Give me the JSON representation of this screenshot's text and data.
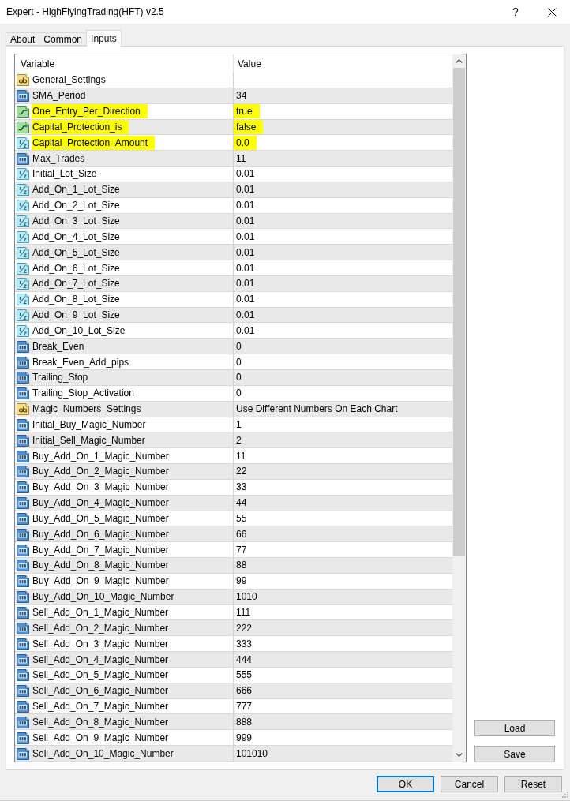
{
  "window": {
    "title": "Expert - HighFlyingTrading(HFT) v2.5",
    "help": "?"
  },
  "tabs": [
    {
      "label": "About",
      "selected": false
    },
    {
      "label": "Common",
      "selected": false
    },
    {
      "label": "Inputs",
      "selected": true
    }
  ],
  "inputs": {
    "columns": [
      "Variable",
      "Value"
    ],
    "rows": [
      {
        "kind": "string",
        "variable": "General_Settings",
        "highlighted": false
      },
      {
        "kind": "int",
        "variable": "SMA_Period",
        "value": "34",
        "highlighted": false
      },
      {
        "kind": "bool",
        "variable": "One_Entry_Per_Direction",
        "value": "true",
        "highlighted": true
      },
      {
        "kind": "bool",
        "variable": "Capital_Protection_is",
        "value": "false",
        "highlighted": true
      },
      {
        "kind": "double",
        "variable": "Capital_Protection_Amount",
        "value": "0.0",
        "highlighted": true
      },
      {
        "kind": "int",
        "variable": "Max_Trades",
        "value": "11",
        "highlighted": false
      },
      {
        "kind": "double",
        "variable": "Initial_Lot_Size",
        "value": "0.01",
        "highlighted": false
      },
      {
        "kind": "double",
        "variable": "Add_On_1_Lot_Size",
        "value": "0.01",
        "highlighted": false
      },
      {
        "kind": "double",
        "variable": "Add_On_2_Lot_Size",
        "value": "0.01",
        "highlighted": false
      },
      {
        "kind": "double",
        "variable": "Add_On_3_Lot_Size",
        "value": "0.01",
        "highlighted": false
      },
      {
        "kind": "double",
        "variable": "Add_On_4_Lot_Size",
        "value": "0.01",
        "highlighted": false
      },
      {
        "kind": "double",
        "variable": "Add_On_5_Lot_Size",
        "value": "0.01",
        "highlighted": false
      },
      {
        "kind": "double",
        "variable": "Add_On_6_Lot_Size",
        "value": "0.01",
        "highlighted": false
      },
      {
        "kind": "double",
        "variable": "Add_On_7_Lot_Size",
        "value": "0.01",
        "highlighted": false
      },
      {
        "kind": "double",
        "variable": "Add_On_8_Lot_Size",
        "value": "0.01",
        "highlighted": false
      },
      {
        "kind": "double",
        "variable": "Add_On_9_Lot_Size",
        "value": "0.01",
        "highlighted": false
      },
      {
        "kind": "double",
        "variable": "Add_On_10_Lot_Size",
        "value": "0.01",
        "highlighted": false
      },
      {
        "kind": "int",
        "variable": "Break_Even",
        "value": "0",
        "highlighted": false
      },
      {
        "kind": "int",
        "variable": "Break_Even_Add_pips",
        "value": "0",
        "highlighted": false
      },
      {
        "kind": "int",
        "variable": "Trailing_Stop",
        "value": "0",
        "highlighted": false
      },
      {
        "kind": "int",
        "variable": "Trailing_Stop_Activation",
        "value": "0",
        "highlighted": false
      },
      {
        "kind": "string",
        "variable": "Magic_Numbers_Settings",
        "value": "Use Different Numbers On Each Chart",
        "highlighted": false
      },
      {
        "kind": "int",
        "variable": "Initial_Buy_Magic_Number",
        "value": "1",
        "highlighted": false
      },
      {
        "kind": "int",
        "variable": "Initial_Sell_Magic_Number",
        "value": "2",
        "highlighted": false
      },
      {
        "kind": "int",
        "variable": "Buy_Add_On_1_Magic_Number",
        "value": "11",
        "highlighted": false
      },
      {
        "kind": "int",
        "variable": "Buy_Add_On_2_Magic_Number",
        "value": "22",
        "highlighted": false
      },
      {
        "kind": "int",
        "variable": "Buy_Add_On_3_Magic_Number",
        "value": "33",
        "highlighted": false
      },
      {
        "kind": "int",
        "variable": "Buy_Add_On_4_Magic_Number",
        "value": "44",
        "highlighted": false
      },
      {
        "kind": "int",
        "variable": "Buy_Add_On_5_Magic_Number",
        "value": "55",
        "highlighted": false
      },
      {
        "kind": "int",
        "variable": "Buy_Add_On_6_Magic_Number",
        "value": "66",
        "highlighted": false
      },
      {
        "kind": "int",
        "variable": "Buy_Add_On_7_Magic_Number",
        "value": "77",
        "highlighted": false
      },
      {
        "kind": "int",
        "variable": "Buy_Add_On_8_Magic_Number",
        "value": "88",
        "highlighted": false
      },
      {
        "kind": "int",
        "variable": "Buy_Add_On_9_Magic_Number",
        "value": "99",
        "highlighted": false
      },
      {
        "kind": "int",
        "variable": "Buy_Add_On_10_Magic_Number",
        "value": "1010",
        "highlighted": false
      },
      {
        "kind": "int",
        "variable": "Sell_Add_On_1_Magic_Number",
        "value": "111",
        "highlighted": false
      },
      {
        "kind": "int",
        "variable": "Sell_Add_On_2_Magic_Number",
        "value": "222",
        "highlighted": false
      },
      {
        "kind": "int",
        "variable": "Sell_Add_On_3_Magic_Number",
        "value": "333",
        "highlighted": false
      },
      {
        "kind": "int",
        "variable": "Sell_Add_On_4_Magic_Number",
        "value": "444",
        "highlighted": false
      },
      {
        "kind": "int",
        "variable": "Sell_Add_On_5_Magic_Number",
        "value": "555",
        "highlighted": false
      },
      {
        "kind": "int",
        "variable": "Sell_Add_On_6_Magic_Number",
        "value": "666",
        "highlighted": false
      },
      {
        "kind": "int",
        "variable": "Sell_Add_On_7_Magic_Number",
        "value": "777",
        "highlighted": false
      },
      {
        "kind": "int",
        "variable": "Sell_Add_On_8_Magic_Number",
        "value": "888",
        "highlighted": false
      },
      {
        "kind": "int",
        "variable": "Sell_Add_On_9_Magic_Number",
        "value": "999",
        "highlighted": false
      },
      {
        "kind": "int",
        "variable": "Sell_Add_On_10_Magic_Number",
        "value": "101010",
        "highlighted": false
      }
    ]
  },
  "side_buttons": [
    "Load",
    "Save"
  ],
  "footer_buttons": [
    {
      "label": "OK",
      "default": true
    },
    {
      "label": "Cancel",
      "default": false
    },
    {
      "label": "Reset",
      "default": false
    }
  ]
}
